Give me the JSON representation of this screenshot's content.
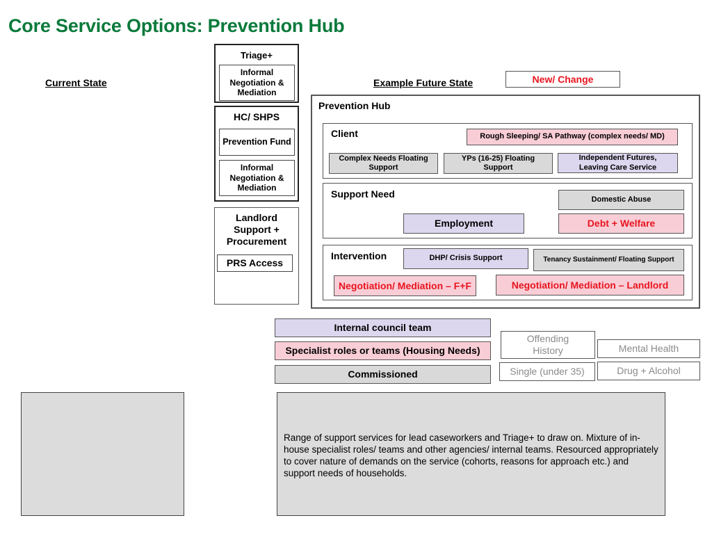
{
  "title": "Core Service Options: Prevention Hub",
  "headings": {
    "current_state": "Current State",
    "future_state": "Example Future State",
    "new_change": "New/ Change"
  },
  "current_column": {
    "triage": {
      "label": "Triage+",
      "items": [
        "Informal Negotiation & Mediation"
      ]
    },
    "hc_shps": {
      "label": "HC/ SHPS",
      "items": [
        "Prevention Fund",
        "Informal Negotiation & Mediation"
      ]
    },
    "landlord": {
      "label": "Landlord Support + Procurement",
      "items": [
        "PRS Access"
      ]
    }
  },
  "hub": {
    "label": "Prevention Hub",
    "client": {
      "label": "Client",
      "items": [
        "Rough Sleeping/ SA Pathway (complex needs/ MD)",
        "Complex Needs Floating Support",
        "YPs (16-25) Floating Support",
        "Independent Futures, Leaving Care Service"
      ]
    },
    "support_need": {
      "label": "Support Need",
      "items": [
        "Domestic Abuse",
        "Employment",
        "Debt + Welfare"
      ]
    },
    "intervention": {
      "label": "Intervention",
      "items": [
        "DHP/ Crisis Support",
        "Tenancy Sustainment/ Floating Support",
        "Negotiation/ Mediation – F+F",
        "Negotiation/ Mediation – Landlord"
      ]
    }
  },
  "legend": {
    "internal": "Internal council team",
    "specialist": "Specialist roles or teams (Housing Needs)",
    "commissioned": "Commissioned"
  },
  "cohorts": [
    "Offending History",
    "Mental Health",
    "Single (under 35)",
    "Drug + Alcohol"
  ],
  "description": "Range of support services for lead caseworkers and Triage+ to draw on. Mixture of in-house specialist roles/ teams and other agencies/ internal teams. Resourced appropriately to cover nature of demands on the service (cohorts, reasons for approach etc.) and support needs of households.",
  "colors": {
    "title_green": "#0b7a3b",
    "new_change_red": "#e8141e",
    "internal_purple": "#dcd6ee",
    "specialist_pink": "#f8cdd6",
    "commissioned_gray": "#d9d9d9"
  }
}
